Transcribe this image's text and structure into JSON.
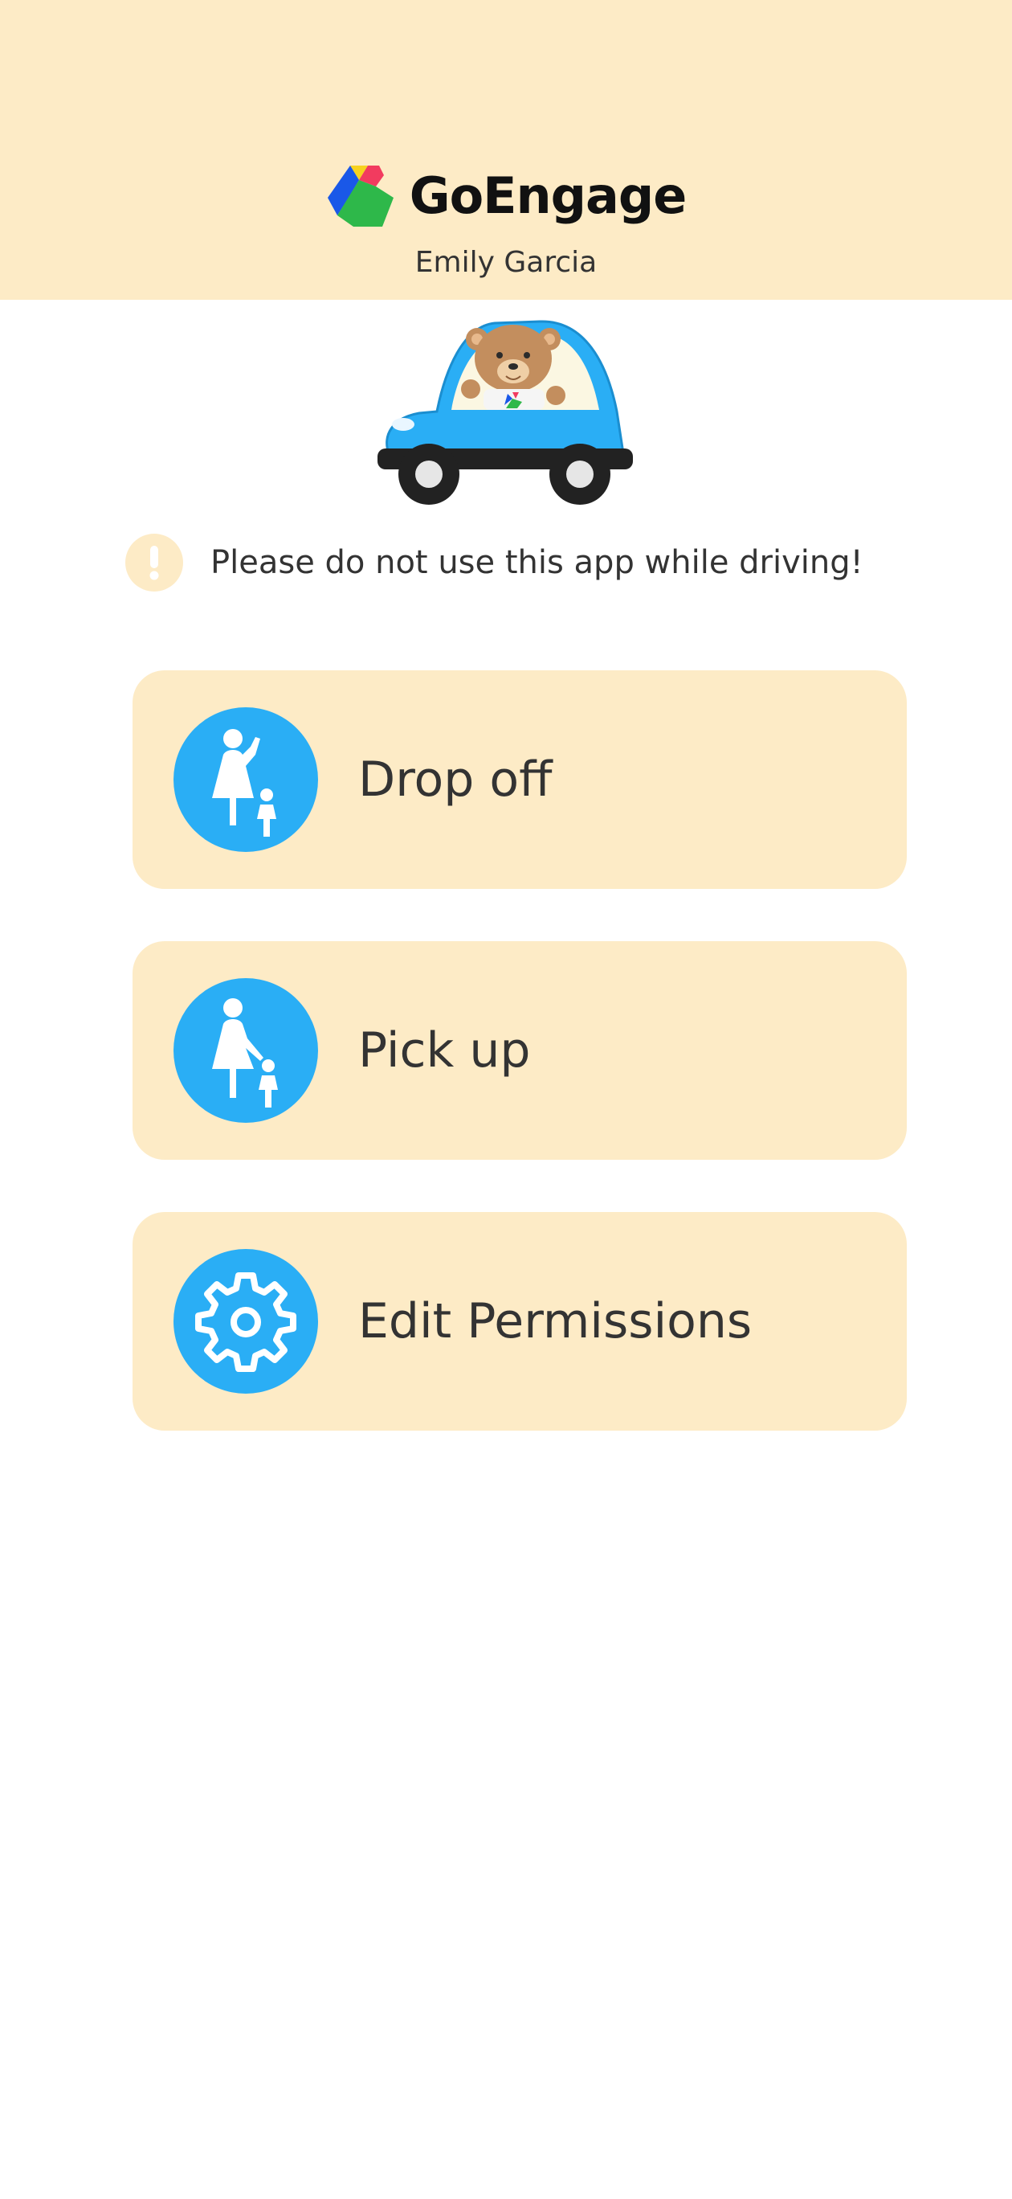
{
  "header": {
    "app_name": "GoEngage",
    "user_name": "Emily Garcia",
    "background_color": "#FDEBC6"
  },
  "illustration": {
    "icon": "teddy-bear-car-illustration"
  },
  "warning": {
    "icon": "exclamation-icon",
    "text": "Please do not use this app while driving!"
  },
  "actions": [
    {
      "label": "Drop off",
      "icon": "parent-child-icon"
    },
    {
      "label": "Pick up",
      "icon": "parent-child-icon"
    },
    {
      "label": "Edit Permissions",
      "icon": "gear-icon"
    }
  ],
  "colors": {
    "accent": "#2AAEF5",
    "card_background": "#FDEBC6",
    "text": "#333333"
  }
}
